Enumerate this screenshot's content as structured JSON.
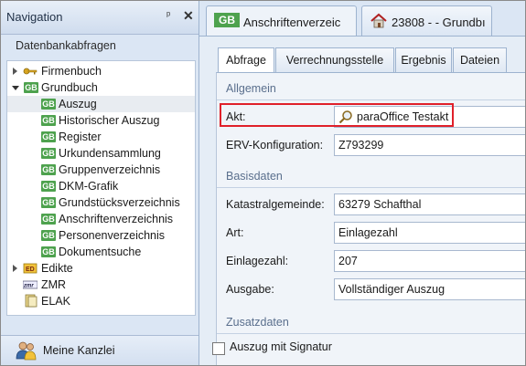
{
  "nav": {
    "title": "Navigation",
    "pin": "ᵖ",
    "close": "✕",
    "section": "Datenbankabfragen",
    "tree": [
      {
        "label": "Firmenbuch",
        "icon": "keys-icon",
        "level": 0,
        "expander": "closed"
      },
      {
        "label": "Grundbuch",
        "icon": "gb-icon",
        "level": 0,
        "expander": "open"
      },
      {
        "label": "Auszug",
        "icon": "gb-icon",
        "level": 1,
        "selected": true
      },
      {
        "label": "Historischer Auszug",
        "icon": "gb-icon",
        "level": 1
      },
      {
        "label": "Register",
        "icon": "gb-icon",
        "level": 1
      },
      {
        "label": "Urkundensammlung",
        "icon": "gb-icon",
        "level": 1
      },
      {
        "label": "Gruppenverzeichnis",
        "icon": "gb-icon",
        "level": 1
      },
      {
        "label": "DKM-Grafik",
        "icon": "gb-icon",
        "level": 1
      },
      {
        "label": "Grundstücksverzeichnis",
        "icon": "gb-icon",
        "level": 1
      },
      {
        "label": "Anschriftenverzeichnis",
        "icon": "gb-icon",
        "level": 1
      },
      {
        "label": "Personenverzeichnis",
        "icon": "gb-icon",
        "level": 1
      },
      {
        "label": "Dokumentsuche",
        "icon": "gb-icon",
        "level": 1
      },
      {
        "label": "Edikte",
        "icon": "edikte-icon",
        "level": 0,
        "expander": "closed"
      },
      {
        "label": "ZMR",
        "icon": "zmr-icon",
        "level": 0
      },
      {
        "label": "ELAK",
        "icon": "elak-icon",
        "level": 0
      }
    ],
    "footer": "Meine Kanzlei"
  },
  "doc_tabs": [
    {
      "badge": "GB",
      "label": "Anschriftenverzeic",
      "active": true
    },
    {
      "label": "23808 -  - Grundbı",
      "active": false
    }
  ],
  "sub_tabs": [
    "Abfrage",
    "Verrechnungsstelle",
    "Ergebnis",
    "Dateien"
  ],
  "form": {
    "section_general": "Allgemein",
    "akt_label": "Akt:",
    "akt_value": "paraOffice Testakt",
    "erv_label": "ERV-Konfiguration:",
    "erv_value": "Z793299",
    "section_basis": "Basisdaten",
    "kg_label": "Katastralgemeinde:",
    "kg_value": "63279 Schafthal",
    "art_label": "Art:",
    "art_value": "Einlagezahl",
    "ez_label": "Einlagezahl:",
    "ez_value": "207",
    "ausgabe_label": "Ausgabe:",
    "ausgabe_value": "Vollständiger Auszug",
    "section_zusatz": "Zusatzdaten",
    "signatur_label": "Auszug mit Signatur"
  },
  "colors": {
    "gb_green": "#4ea24e",
    "highlight_red": "#e0202a"
  }
}
